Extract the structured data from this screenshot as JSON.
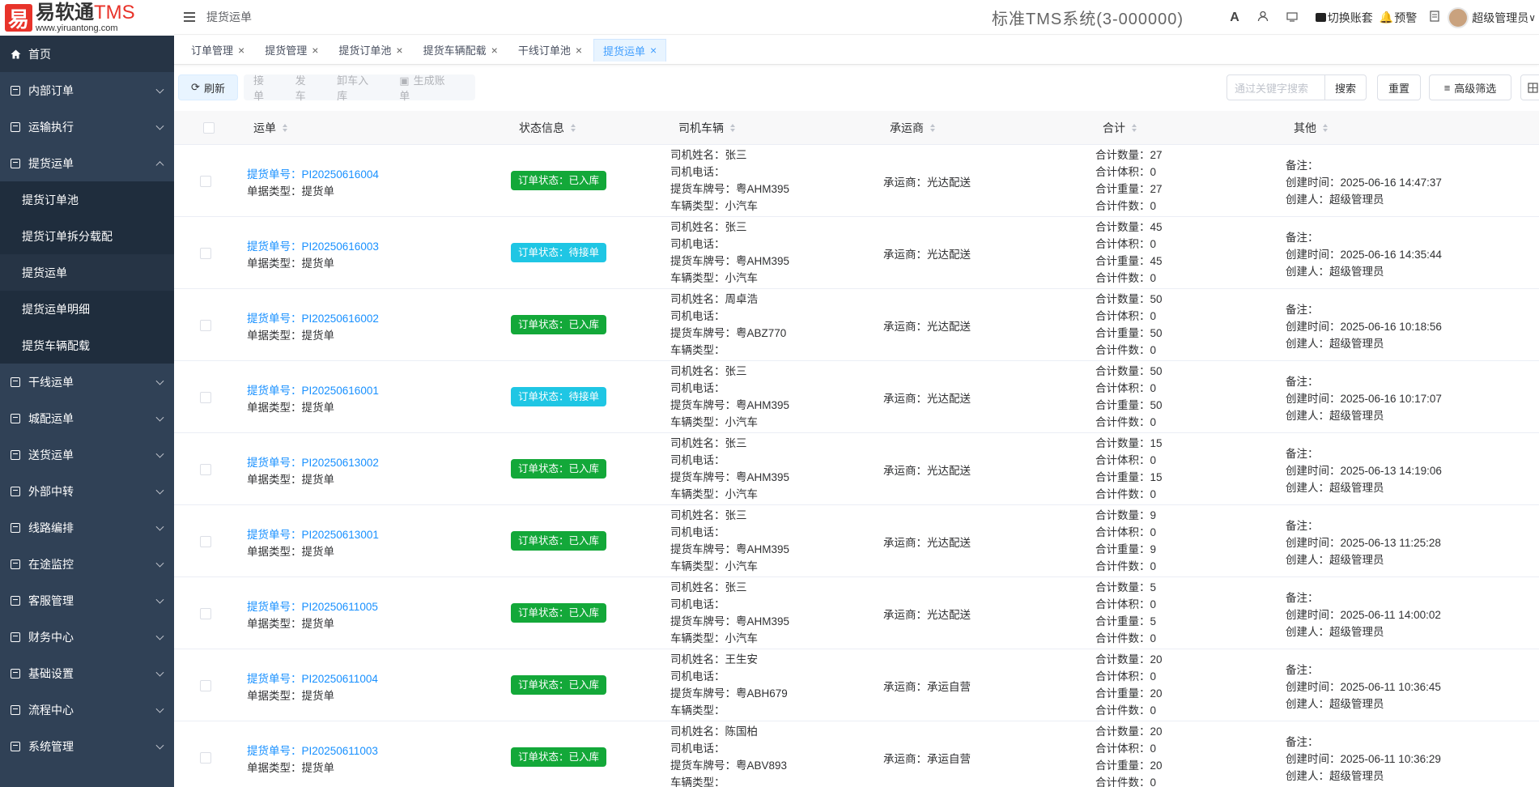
{
  "brand": {
    "mark": "易",
    "name": "易软通",
    "suffix": "TMS",
    "url": "www.yiruantong.com"
  },
  "sidebar": {
    "items": [
      {
        "label": "首页",
        "type": "home"
      },
      {
        "label": "内部订单",
        "type": "group"
      },
      {
        "label": "运输执行",
        "type": "group"
      },
      {
        "label": "提货运单",
        "type": "group-open"
      },
      {
        "label": "提货订单池",
        "type": "sub"
      },
      {
        "label": "提货订单拆分载配",
        "type": "sub"
      },
      {
        "label": "提货运单",
        "type": "sub-active"
      },
      {
        "label": "提货运单明细",
        "type": "sub"
      },
      {
        "label": "提货车辆配载",
        "type": "sub"
      },
      {
        "label": "干线运单",
        "type": "group"
      },
      {
        "label": "城配运单",
        "type": "group"
      },
      {
        "label": "送货运单",
        "type": "group"
      },
      {
        "label": "外部中转",
        "type": "group"
      },
      {
        "label": "线路编排",
        "type": "group"
      },
      {
        "label": "在途监控",
        "type": "group"
      },
      {
        "label": "客服管理",
        "type": "group"
      },
      {
        "label": "财务中心",
        "type": "group"
      },
      {
        "label": "基础设置",
        "type": "group"
      },
      {
        "label": "流程中心",
        "type": "group"
      },
      {
        "label": "系统管理",
        "type": "group"
      }
    ]
  },
  "header": {
    "breadcrumb": "提货运单",
    "system_title": "标准TMS系统(3-000000)",
    "switch_label": "切换账套",
    "alert_label": "预警",
    "user": "超级管理员"
  },
  "tabs": [
    {
      "label": "订单管理",
      "active": false
    },
    {
      "label": "提货管理",
      "active": false
    },
    {
      "label": "提货订单池",
      "active": false
    },
    {
      "label": "提货车辆配载",
      "active": false
    },
    {
      "label": "干线订单池",
      "active": false
    },
    {
      "label": "提货运单",
      "active": true
    }
  ],
  "toolbar": {
    "refresh": "刷新",
    "accept": "接单",
    "dispatch": "发车",
    "unload": "卸车入库",
    "generate": "生成账单",
    "search_placeholder": "通过关键字搜索",
    "search": "搜索",
    "reset": "重置",
    "advanced": "高级筛选"
  },
  "table": {
    "columns": [
      "运单",
      "状态信息",
      "司机车辆",
      "承运商",
      "合计",
      "其他"
    ],
    "labels": {
      "order_no": "提货单号：",
      "doc_type": "单据类型：",
      "status_prefix": "订单状态：",
      "driver": "司机姓名：",
      "phone": "司机电话：",
      "plate": "提货车牌号：",
      "vehicle": "车辆类型：",
      "carrier": "承运商：",
      "qty": "合计数量：",
      "vol": "合计体积：",
      "weight": "合计重量：",
      "pieces": "合计件数：",
      "remark": "备注：",
      "created": "创建时间：",
      "creator": "创建人："
    },
    "rows": [
      {
        "order": "PI20250616004",
        "type": "提货单",
        "status": "已入库",
        "driver": "张三",
        "phone": "",
        "plate": "粤AHM395",
        "vehicle": "小汽车",
        "carrier": "光达配送",
        "qty": "27",
        "vol": "0",
        "weight": "27",
        "pieces": "0",
        "remark": "",
        "created": "2025-06-16 14:47:37",
        "creator": "超级管理员"
      },
      {
        "order": "PI20250616003",
        "type": "提货单",
        "status": "待接单",
        "driver": "张三",
        "phone": "",
        "plate": "粤AHM395",
        "vehicle": "小汽车",
        "carrier": "光达配送",
        "qty": "45",
        "vol": "0",
        "weight": "45",
        "pieces": "0",
        "remark": "",
        "created": "2025-06-16 14:35:44",
        "creator": "超级管理员"
      },
      {
        "order": "PI20250616002",
        "type": "提货单",
        "status": "已入库",
        "driver": "周卓浩",
        "phone": "",
        "plate": "粤ABZ770",
        "vehicle": "",
        "carrier": "光达配送",
        "qty": "50",
        "vol": "0",
        "weight": "50",
        "pieces": "0",
        "remark": "",
        "created": "2025-06-16 10:18:56",
        "creator": "超级管理员"
      },
      {
        "order": "PI20250616001",
        "type": "提货单",
        "status": "待接单",
        "driver": "张三",
        "phone": "",
        "plate": "粤AHM395",
        "vehicle": "小汽车",
        "carrier": "光达配送",
        "qty": "50",
        "vol": "0",
        "weight": "50",
        "pieces": "0",
        "remark": "",
        "created": "2025-06-16 10:17:07",
        "creator": "超级管理员"
      },
      {
        "order": "PI20250613002",
        "type": "提货单",
        "status": "已入库",
        "driver": "张三",
        "phone": "",
        "plate": "粤AHM395",
        "vehicle": "小汽车",
        "carrier": "光达配送",
        "qty": "15",
        "vol": "0",
        "weight": "15",
        "pieces": "0",
        "remark": "",
        "created": "2025-06-13 14:19:06",
        "creator": "超级管理员"
      },
      {
        "order": "PI20250613001",
        "type": "提货单",
        "status": "已入库",
        "driver": "张三",
        "phone": "",
        "plate": "粤AHM395",
        "vehicle": "小汽车",
        "carrier": "光达配送",
        "qty": "9",
        "vol": "0",
        "weight": "9",
        "pieces": "0",
        "remark": "",
        "created": "2025-06-13 11:25:28",
        "creator": "超级管理员"
      },
      {
        "order": "PI20250611005",
        "type": "提货单",
        "status": "已入库",
        "driver": "张三",
        "phone": "",
        "plate": "粤AHM395",
        "vehicle": "小汽车",
        "carrier": "光达配送",
        "qty": "5",
        "vol": "0",
        "weight": "5",
        "pieces": "0",
        "remark": "",
        "created": "2025-06-11 14:00:02",
        "creator": "超级管理员"
      },
      {
        "order": "PI20250611004",
        "type": "提货单",
        "status": "已入库",
        "driver": "王生安",
        "phone": "",
        "plate": "粤ABH679",
        "vehicle": "",
        "carrier": "承运自营",
        "qty": "20",
        "vol": "0",
        "weight": "20",
        "pieces": "0",
        "remark": "",
        "created": "2025-06-11 10:36:45",
        "creator": "超级管理员"
      },
      {
        "order": "PI20250611003",
        "type": "提货单",
        "status": "已入库",
        "driver": "陈国柏",
        "phone": "",
        "plate": "粤ABV893",
        "vehicle": "",
        "carrier": "承运自营",
        "qty": "20",
        "vol": "0",
        "weight": "20",
        "pieces": "0",
        "remark": "",
        "created": "2025-06-11 10:36:29",
        "creator": "超级管理员"
      }
    ]
  },
  "colors": {
    "sidebar": "#304156",
    "primary": "#1890ff",
    "status_done": "#13a839",
    "status_pending": "#1fc6e4"
  }
}
